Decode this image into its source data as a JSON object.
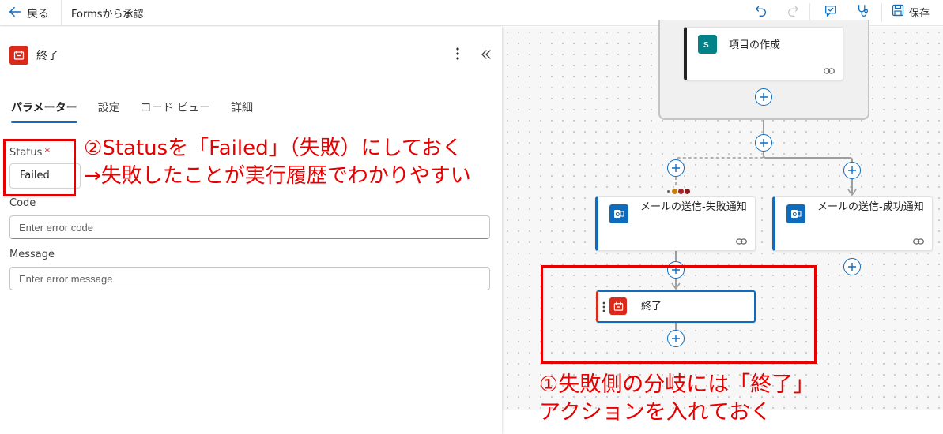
{
  "topbar": {
    "back_label": "戻る",
    "flow_title": "Formsから承認",
    "save_label": "保存"
  },
  "panel": {
    "title": "終了",
    "tabs": [
      {
        "label": "パラメーター",
        "active": true
      },
      {
        "label": "設定",
        "active": false
      },
      {
        "label": "コード ビュー",
        "active": false
      },
      {
        "label": "詳細",
        "active": false
      }
    ],
    "fields": {
      "status_label": "Status",
      "status_required": "*",
      "status_value": "Failed",
      "code_label": "Code",
      "code_placeholder": "Enter error code",
      "message_label": "Message",
      "message_placeholder": "Enter error message"
    }
  },
  "canvas": {
    "create_item_label": "項目の作成",
    "send_mail_failure_label": "メールの送信-失敗通知",
    "send_mail_success_label": "メールの送信-成功通知",
    "terminate_label": "終了"
  },
  "annotations": {
    "status_note_line1": "②Statusを「Failed」（失敗）にしておく",
    "status_note_line2": "→失敗したことが実行履歴でわかりやすい",
    "branch_note_line1": "①失敗側の分岐には「終了」",
    "branch_note_line2": "アクションを入れておく"
  },
  "colors": {
    "accent": "#0f6cbd",
    "terminate_red": "#d92a1a",
    "annotation_red": "#e60000",
    "sharepoint_teal": "#038387",
    "outlook_blue": "#0f6cbd"
  }
}
